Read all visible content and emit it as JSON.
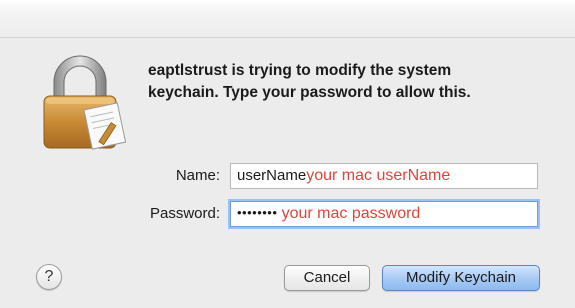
{
  "dialog": {
    "message_line1": "eaptlstrust is trying to modify the system",
    "message_line2": "keychain. Type your password to allow this."
  },
  "form": {
    "name_label": "Name:",
    "name_value": "userName",
    "name_hint": "your mac userName",
    "password_label": "Password:",
    "password_dots": "••••••••",
    "password_hint": "your mac password"
  },
  "buttons": {
    "help_label": "?",
    "cancel_label": "Cancel",
    "primary_label": "Modify Keychain"
  },
  "icons": {
    "lock": "lock-icon",
    "help": "help-icon"
  },
  "colors": {
    "hint": "#e0443a",
    "primary_button": "#a9cbf3",
    "focus_ring": "#9cc0ef"
  }
}
